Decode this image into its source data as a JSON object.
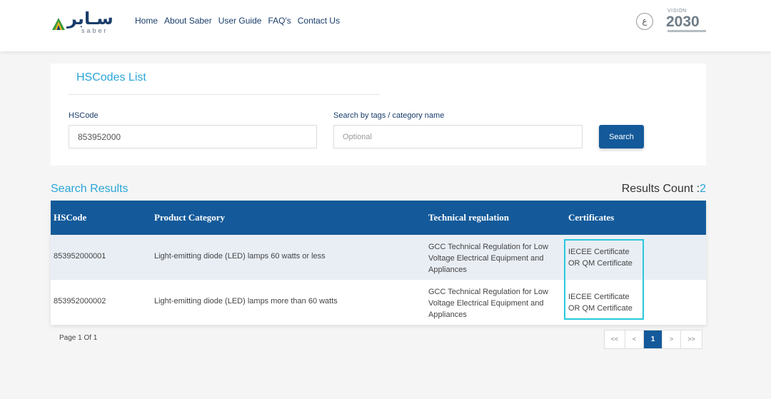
{
  "header": {
    "logo_arabic": "سـابر",
    "logo_latin": "saber",
    "nav": [
      "Home",
      "About Saber",
      "User Guide",
      "FAQ's",
      "Contact Us"
    ],
    "lang_toggle": "ع",
    "vision_label": "VISION",
    "vision_year": "2030"
  },
  "search_card": {
    "title": "HSCodes List",
    "hscode_label": "HSCode",
    "hscode_value": "853952000",
    "tags_label": "Search by tags / category name",
    "tags_value": "",
    "tags_placeholder": "Optional",
    "search_button": "Search"
  },
  "results": {
    "title": "Search Results",
    "count_label": "Results Count :",
    "count_value": "2",
    "columns": [
      "HSCode",
      "Product Category",
      "Technical regulation",
      "Certificates"
    ],
    "rows": [
      {
        "hscode": "853952000001",
        "category": "Light-emitting diode (LED) lamps 60 watts or less",
        "regulation": "GCC Technical Regulation for Low Voltage Electrical Equipment and Appliances",
        "certificates": "IECEE Certificate OR QM Certificate"
      },
      {
        "hscode": "853952000002",
        "category": "Light-emitting diode (LED) lamps more than 60 watts",
        "regulation": "GCC Technical Regulation for Low Voltage Electrical Equipment and Appliances",
        "certificates": "IECEE Certificate OR QM Certificate"
      }
    ]
  },
  "pagination": {
    "page_info": "Page 1 Of 1",
    "first": "<<",
    "prev": "<",
    "current": "1",
    "next": ">",
    "last": ">>"
  },
  "colors": {
    "primary": "#145a9a",
    "accent": "#2aa6d9",
    "highlight": "#28c8dc",
    "row_alt": "#e9eef5"
  }
}
